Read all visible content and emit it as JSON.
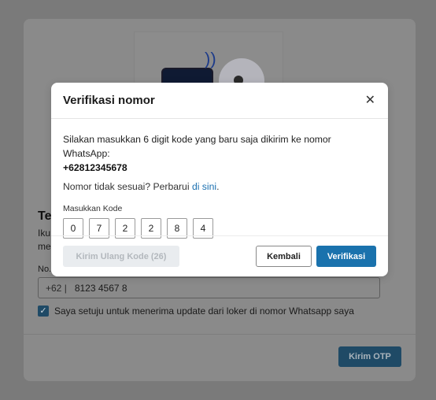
{
  "background": {
    "heading": "Te",
    "subtext_line1": "Iku",
    "subtext_line2": "me",
    "phone_label": "No.",
    "phone_prefix": "+62 |",
    "phone_value": "8123 4567 8",
    "checkbox_label": "Saya setuju untuk menerima update dari loker di nomor Whatsapp saya",
    "checkbox_checked": true,
    "send_otp_label": "Kirim OTP"
  },
  "modal": {
    "title": "Verifikasi nomor",
    "close_icon": "close-icon",
    "message": "Silakan masukkan 6 digit kode yang baru saja dikirim ke nomor WhatsApp:",
    "phone_number": "+62812345678",
    "mismatch_text": "Nomor tidak sesuai? Perbarui",
    "mismatch_link": "di sini",
    "mismatch_end": ".",
    "code_label": "Masukkan Kode",
    "code_digits": [
      "0",
      "7",
      "2",
      "2",
      "8",
      "4"
    ],
    "resend_label": "Kirim Ulang Kode (26)",
    "back_label": "Kembali",
    "verify_label": "Verifikasi"
  },
  "colors": {
    "primary": "#1a72ad",
    "link": "#1a6fb0",
    "disabled_bg": "#e9ecef"
  }
}
